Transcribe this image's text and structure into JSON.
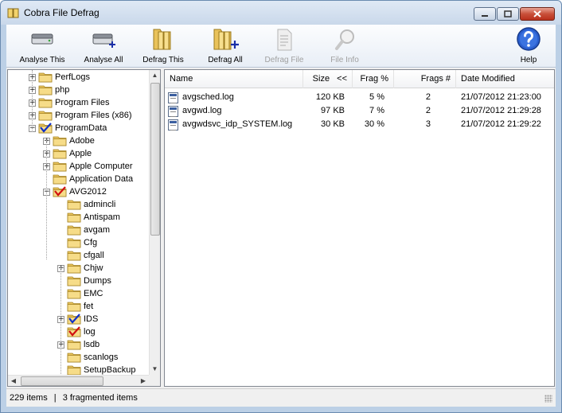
{
  "window": {
    "title": "Cobra File Defrag"
  },
  "toolbar": {
    "analyse_this": "Analyse This",
    "analyse_all": "Analyse All",
    "defrag_this": "Defrag This",
    "defrag_all": "Defrag All",
    "defrag_file": "Defrag File",
    "file_info": "File Info",
    "help": "Help"
  },
  "tree": {
    "items": [
      {
        "label": "PerfLogs",
        "level": 1,
        "expander": "+",
        "check": ""
      },
      {
        "label": "php",
        "level": 1,
        "expander": "+",
        "check": ""
      },
      {
        "label": "Program Files",
        "level": 1,
        "expander": "+",
        "check": ""
      },
      {
        "label": "Program Files (x86)",
        "level": 1,
        "expander": "+",
        "check": ""
      },
      {
        "label": "ProgramData",
        "level": 1,
        "expander": "−",
        "check": "blue"
      },
      {
        "label": "Adobe",
        "level": 2,
        "expander": "+",
        "check": ""
      },
      {
        "label": "Apple",
        "level": 2,
        "expander": "+",
        "check": ""
      },
      {
        "label": "Apple Computer",
        "level": 2,
        "expander": "+",
        "check": ""
      },
      {
        "label": "Application Data",
        "level": 2,
        "expander": "",
        "check": ""
      },
      {
        "label": "AVG2012",
        "level": 2,
        "expander": "−",
        "check": "red"
      },
      {
        "label": "admincli",
        "level": 3,
        "expander": "",
        "check": ""
      },
      {
        "label": "Antispam",
        "level": 3,
        "expander": "",
        "check": ""
      },
      {
        "label": "avgam",
        "level": 3,
        "expander": "",
        "check": ""
      },
      {
        "label": "Cfg",
        "level": 3,
        "expander": "",
        "check": ""
      },
      {
        "label": "cfgall",
        "level": 3,
        "expander": "",
        "check": ""
      },
      {
        "label": "Chjw",
        "level": 3,
        "expander": "+",
        "check": ""
      },
      {
        "label": "Dumps",
        "level": 3,
        "expander": "",
        "check": ""
      },
      {
        "label": "EMC",
        "level": 3,
        "expander": "",
        "check": ""
      },
      {
        "label": "fet",
        "level": 3,
        "expander": "",
        "check": ""
      },
      {
        "label": "IDS",
        "level": 3,
        "expander": "+",
        "check": "blue"
      },
      {
        "label": "log",
        "level": 3,
        "expander": "",
        "check": "red"
      },
      {
        "label": "lsdb",
        "level": 3,
        "expander": "+",
        "check": ""
      },
      {
        "label": "scanlogs",
        "level": 3,
        "expander": "",
        "check": ""
      },
      {
        "label": "SetupBackup",
        "level": 3,
        "expander": "",
        "check": ""
      }
    ]
  },
  "list": {
    "columns": {
      "name": "Name",
      "size": "Size",
      "size_sort": "<<",
      "frag": "Frag %",
      "frags": "Frags #",
      "modified": "Date Modified"
    },
    "rows": [
      {
        "name": "avgsched.log",
        "size": "120 KB",
        "frag": "5 %",
        "frags": "2",
        "modified": "21/07/2012 21:23:00"
      },
      {
        "name": "avgwd.log",
        "size": "97 KB",
        "frag": "7 %",
        "frags": "2",
        "modified": "21/07/2012 21:29:28"
      },
      {
        "name": "avgwdsvc_idp_SYSTEM.log",
        "size": "30 KB",
        "frag": "30 %",
        "frags": "3",
        "modified": "21/07/2012 21:29:22"
      }
    ]
  },
  "status": {
    "items": "229 items",
    "separator": "|",
    "fragmented": "3 fragmented items"
  }
}
